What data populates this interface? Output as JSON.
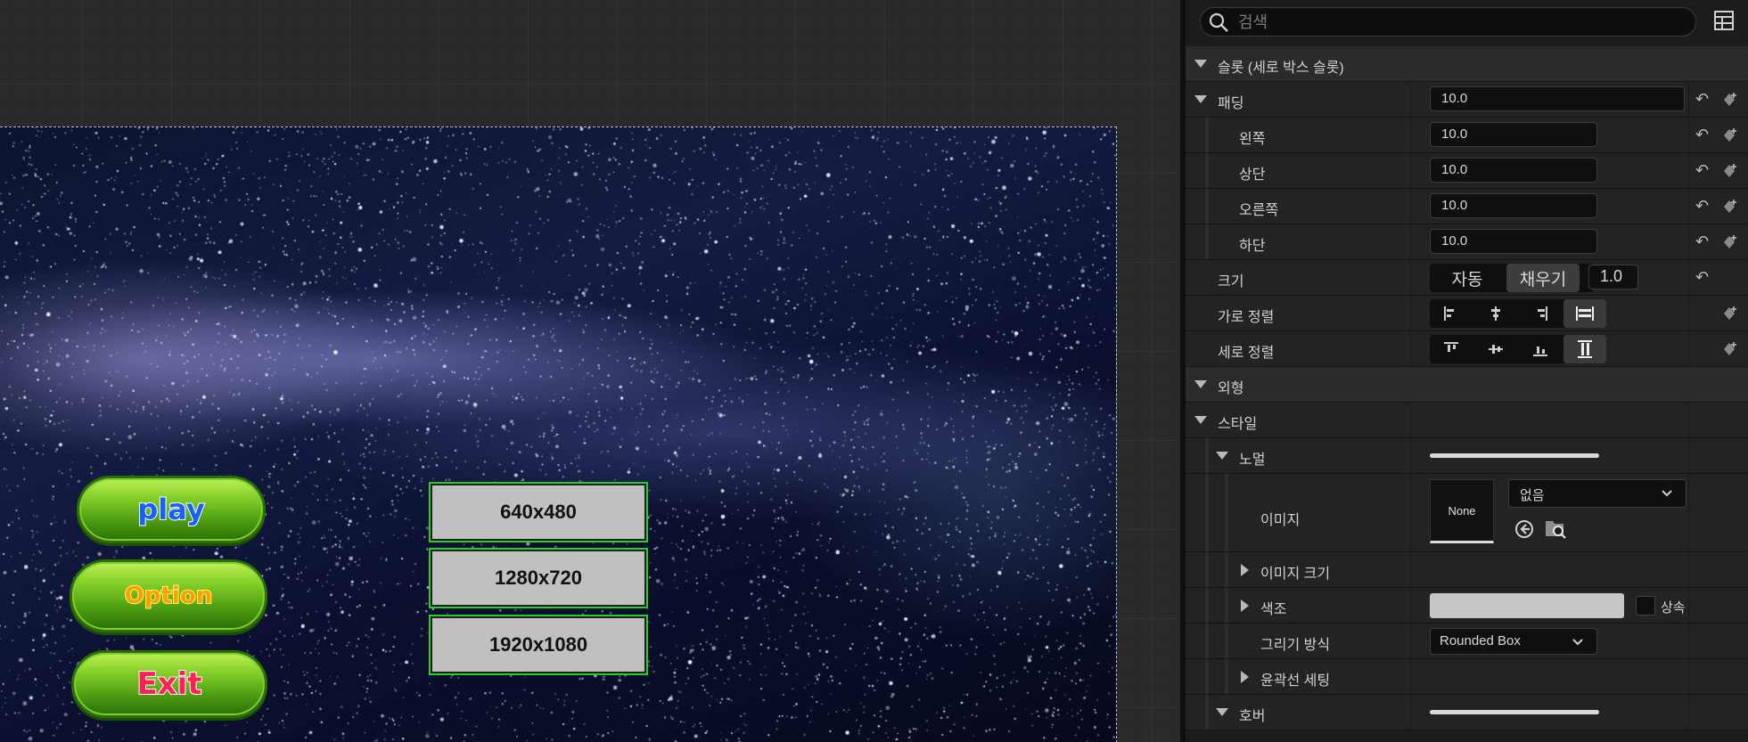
{
  "viewport": {
    "main_buttons": {
      "play": "play",
      "option": "Option",
      "exit": "Exit"
    },
    "resolution_buttons": [
      "640x480",
      "1280x720",
      "1920x1080"
    ]
  },
  "details": {
    "search_placeholder": "검색",
    "slot_header": "슬롯 (세로 박스 슬롯)",
    "padding": {
      "label": "패딩",
      "value": "10.0",
      "left": {
        "label": "왼쪽",
        "value": "10.0"
      },
      "top": {
        "label": "상단",
        "value": "10.0"
      },
      "right": {
        "label": "오른쪽",
        "value": "10.0"
      },
      "bottom": {
        "label": "하단",
        "value": "10.0"
      }
    },
    "size": {
      "label": "크기",
      "auto": "자동",
      "fill": "채우기",
      "value": "1.0",
      "selected": "채우기"
    },
    "h_align": {
      "label": "가로 정렬",
      "selected": "fill"
    },
    "v_align": {
      "label": "세로 정렬",
      "selected": "fill"
    },
    "appearance_header": "외형",
    "style_header": "스타일",
    "normal": {
      "label": "노멀",
      "image_label": "이미지",
      "image_preview": "None",
      "image_dropdown": "없음",
      "image_size_label": "이미지 크기",
      "tint_label": "색조",
      "tint_color": "#c6c6c6",
      "inherit_label": "상속",
      "draw_as_label": "그리기 방식",
      "draw_as_value": "Rounded Box",
      "outline_label": "윤곽선 세팅"
    },
    "hover_label": "호버"
  },
  "colors": {
    "button_green": "#5fb81a",
    "resolution_outline": "#23d12c",
    "panel_bg": "#1c1c1c"
  }
}
